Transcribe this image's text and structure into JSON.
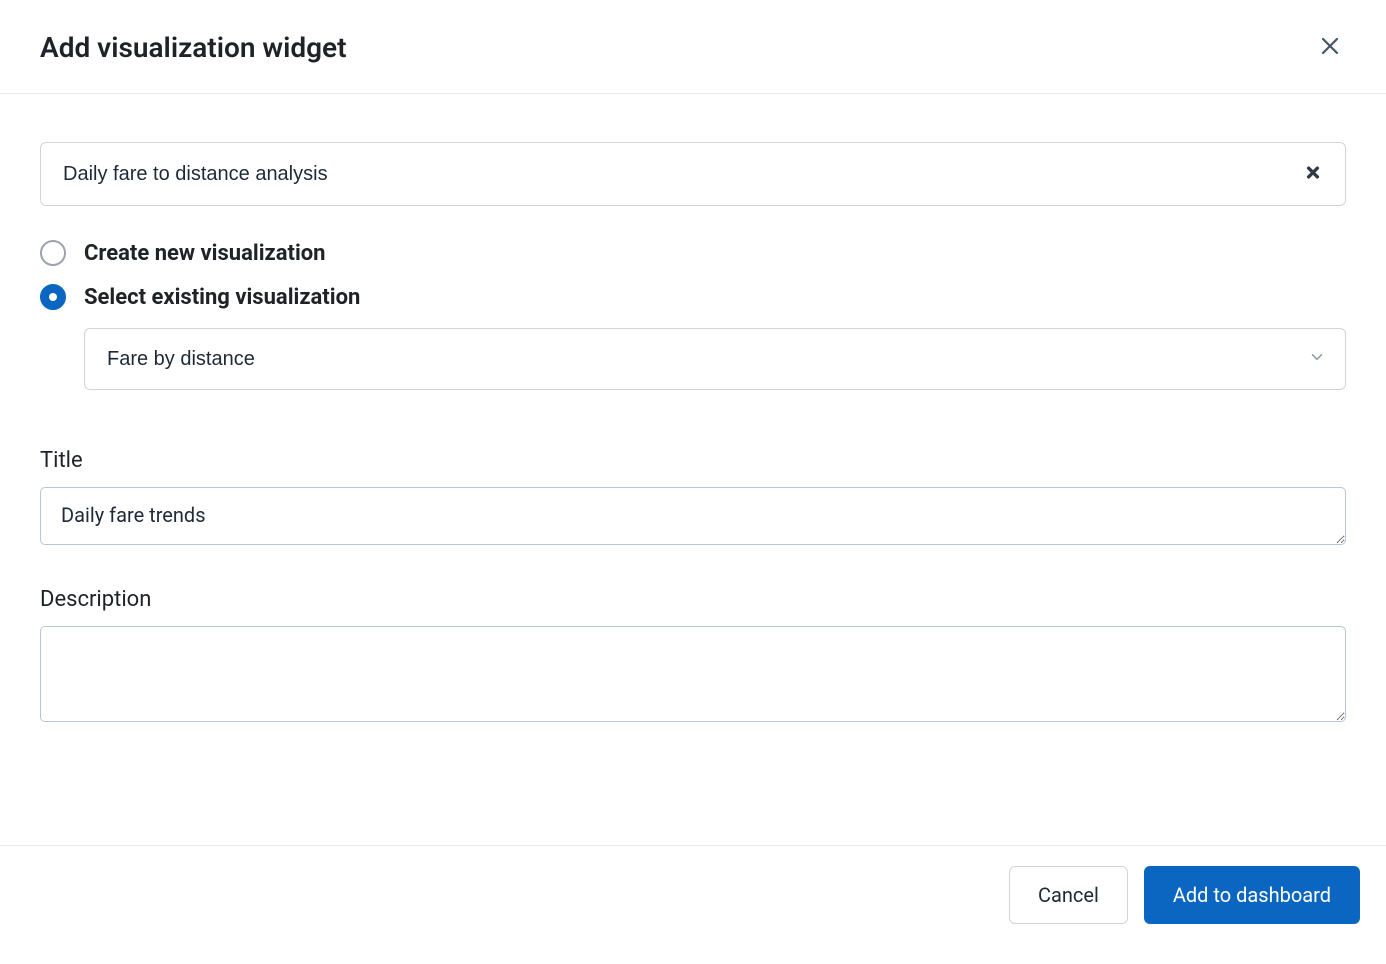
{
  "header": {
    "title": "Add visualization widget"
  },
  "search": {
    "value": "Daily fare to distance analysis"
  },
  "radios": {
    "create_label": "Create new visualization",
    "select_label": "Select existing visualization",
    "selected": "existing"
  },
  "visualization_select": {
    "value": "Fare by distance"
  },
  "title_field": {
    "label": "Title",
    "value": "Daily fare trends"
  },
  "description_field": {
    "label": "Description",
    "value": ""
  },
  "footer": {
    "cancel_label": "Cancel",
    "submit_label": "Add to dashboard"
  },
  "colors": {
    "primary": "#0b66c2",
    "border": "#d1d5db",
    "input_border": "#b7c6d6",
    "text": "#1f2328"
  }
}
